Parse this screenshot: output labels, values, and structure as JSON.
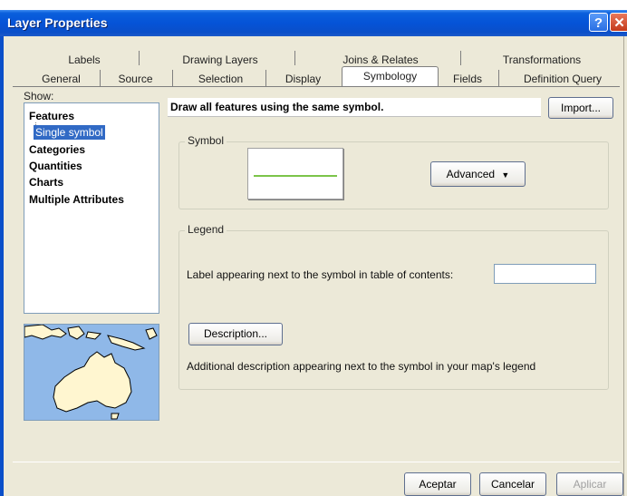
{
  "window": {
    "title": "Layer Properties"
  },
  "tabs_back": [
    {
      "label": "Labels"
    },
    {
      "label": "Drawing Layers"
    },
    {
      "label": "Joins & Relates"
    },
    {
      "label": "Transformations"
    }
  ],
  "tabs_front": [
    {
      "label": "General"
    },
    {
      "label": "Source"
    },
    {
      "label": "Selection"
    },
    {
      "label": "Display"
    },
    {
      "label": "Symbology",
      "active": true
    },
    {
      "label": "Fields"
    },
    {
      "label": "Definition Query"
    }
  ],
  "show": {
    "label": "Show:",
    "items": [
      {
        "label": "Features"
      },
      {
        "label": "Single symbol",
        "selected": true
      },
      {
        "label": "Categories"
      },
      {
        "label": "Quantities"
      },
      {
        "label": "Charts"
      },
      {
        "label": "Multiple Attributes"
      }
    ]
  },
  "main": {
    "header": "Draw all features using the same symbol.",
    "import_label": "Import...",
    "symbol_group": "Symbol",
    "advanced_label": "Advanced",
    "symbol_line_color": "#7cc44a",
    "legend_group": "Legend",
    "label_prompt": "Label appearing next to the symbol in table of contents:",
    "label_value": "",
    "description_label": "Description...",
    "description_note": "Additional description appearing next to the symbol in your map's legend"
  },
  "footer": {
    "accept": "Aceptar",
    "cancel": "Cancelar",
    "apply": "Aplicar"
  },
  "colors": {
    "title_bar": "#0553d7",
    "selection": "#316ac5",
    "dialog_bg": "#ece9d8"
  },
  "icons": [
    "help-icon",
    "close-icon",
    "dropdown-arrow-icon"
  ]
}
